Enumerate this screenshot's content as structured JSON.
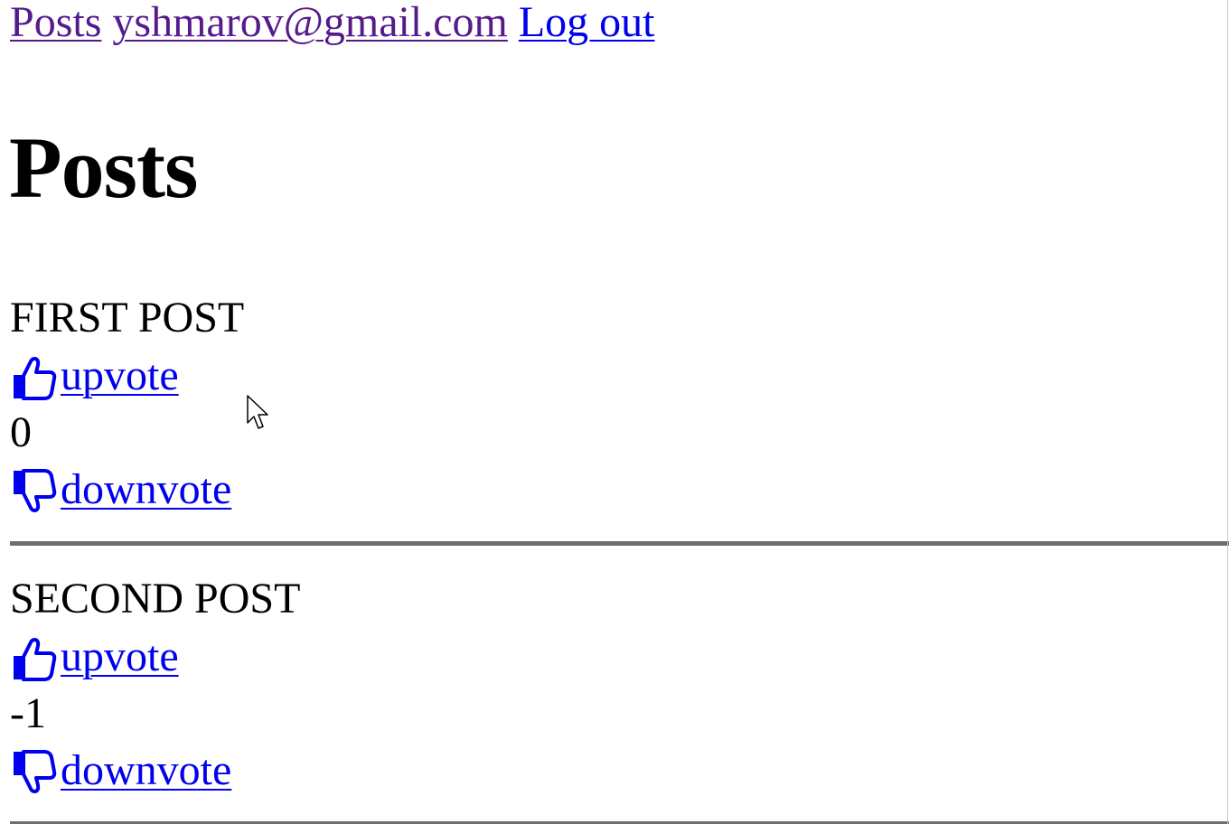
{
  "nav": {
    "posts_link": "Posts",
    "user_email": "yshmarov@gmail.com",
    "logout_link": "Log out"
  },
  "page_title": "Posts",
  "posts": [
    {
      "title": "FIRST POST",
      "upvote_label": " upvote",
      "score": "0",
      "downvote_label": " downvote"
    },
    {
      "title": "SECOND POST",
      "upvote_label": " upvote",
      "score": "-1",
      "downvote_label": " downvote"
    }
  ],
  "icons": {
    "upvote": "thumbs-up-icon",
    "downvote": "thumbs-down-icon",
    "cursor": "mouse-pointer-icon"
  },
  "colors": {
    "link": "#0000ee",
    "visited_link": "#551a8b",
    "text": "#000000",
    "divider": "#6e6e6e"
  }
}
